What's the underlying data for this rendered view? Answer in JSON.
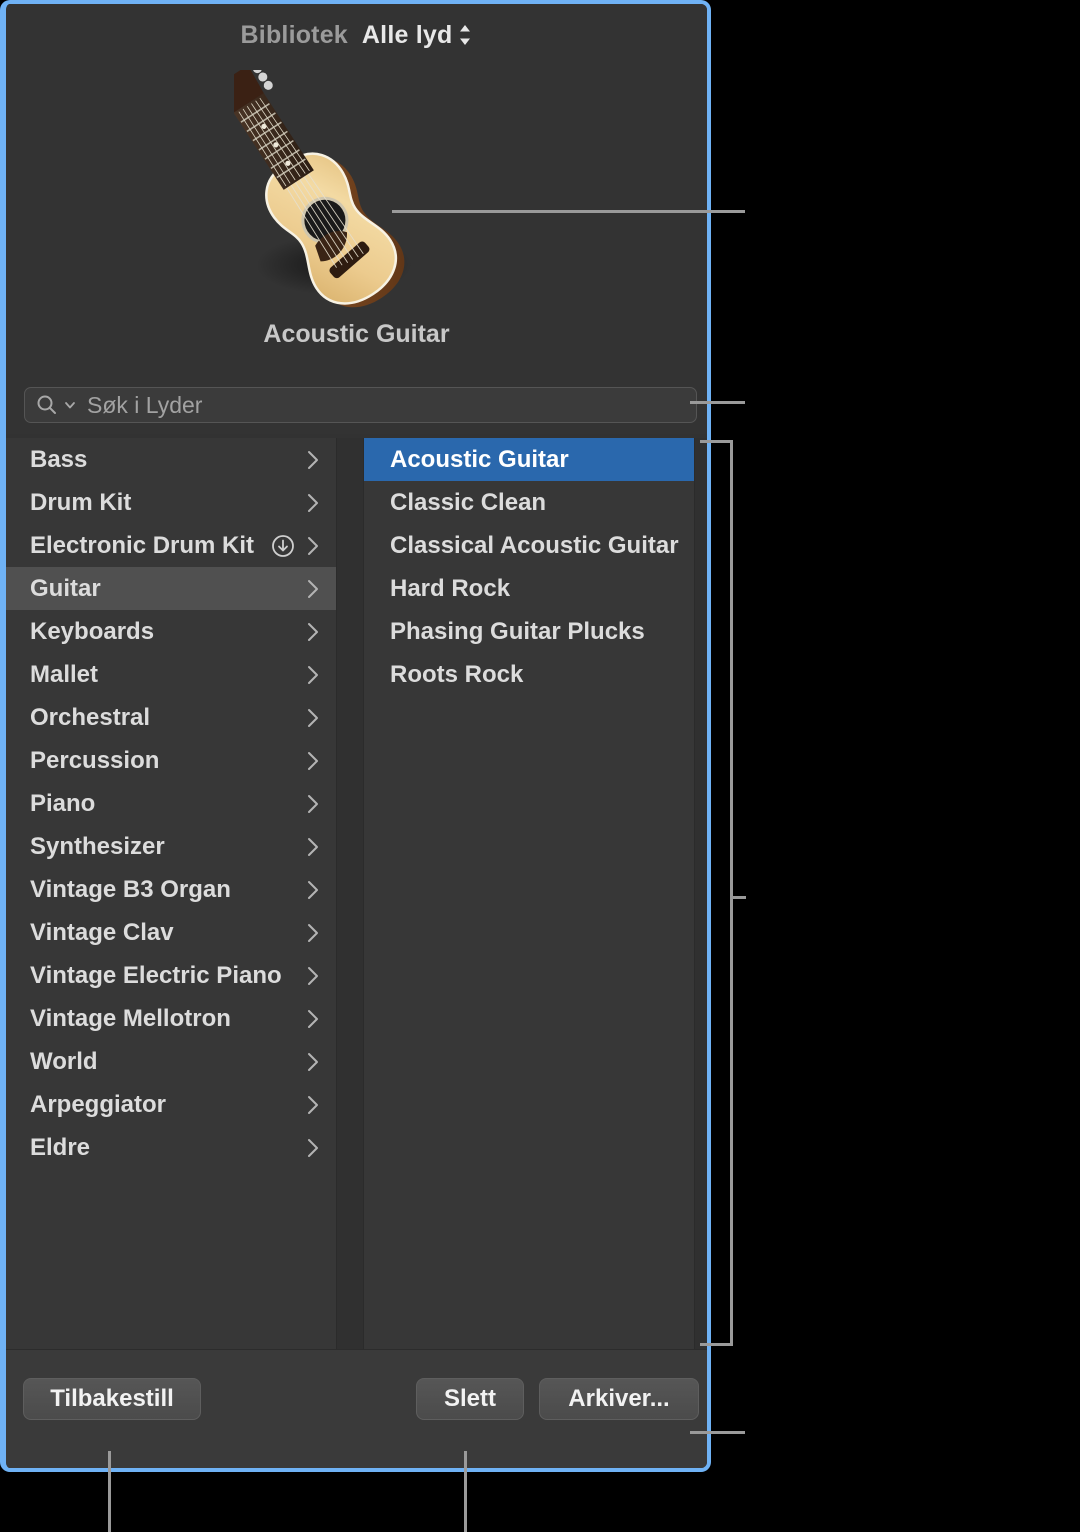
{
  "window": {
    "border_color": "#6fb2f5",
    "background": "#323232"
  },
  "header": {
    "title": "Bibliotek",
    "scope_label": "Alle lyd",
    "scope_icon": "stepper-updown-icon"
  },
  "preview": {
    "artwork_icon": "acoustic-guitar-image",
    "caption": "Acoustic Guitar"
  },
  "search": {
    "placeholder": "Søk i Lyder",
    "value": "",
    "icon": "search-icon",
    "chevron_icon": "chevron-down-icon"
  },
  "browser": {
    "categories": [
      {
        "label": "Bass",
        "selected": false,
        "has_download": false
      },
      {
        "label": "Drum Kit",
        "selected": false,
        "has_download": false
      },
      {
        "label": "Electronic Drum Kit",
        "selected": false,
        "has_download": true
      },
      {
        "label": "Guitar",
        "selected": true,
        "has_download": false
      },
      {
        "label": "Keyboards",
        "selected": false,
        "has_download": false
      },
      {
        "label": "Mallet",
        "selected": false,
        "has_download": false
      },
      {
        "label": "Orchestral",
        "selected": false,
        "has_download": false
      },
      {
        "label": "Percussion",
        "selected": false,
        "has_download": false
      },
      {
        "label": "Piano",
        "selected": false,
        "has_download": false
      },
      {
        "label": "Synthesizer",
        "selected": false,
        "has_download": false
      },
      {
        "label": "Vintage B3 Organ",
        "selected": false,
        "has_download": false
      },
      {
        "label": "Vintage Clav",
        "selected": false,
        "has_download": false
      },
      {
        "label": "Vintage Electric Piano",
        "selected": false,
        "has_download": false
      },
      {
        "label": "Vintage Mellotron",
        "selected": false,
        "has_download": false
      },
      {
        "label": "World",
        "selected": false,
        "has_download": false
      },
      {
        "label": "Arpeggiator",
        "selected": false,
        "has_download": false
      },
      {
        "label": "Eldre",
        "selected": false,
        "has_download": false
      }
    ],
    "patches": [
      {
        "label": "Acoustic Guitar",
        "selected": true
      },
      {
        "label": "Classic Clean",
        "selected": false
      },
      {
        "label": "Classical Acoustic Guitar",
        "selected": false
      },
      {
        "label": "Hard Rock",
        "selected": false
      },
      {
        "label": "Phasing Guitar Plucks",
        "selected": false
      },
      {
        "label": "Roots Rock",
        "selected": false
      }
    ],
    "selection_color": "#2a68ad",
    "category_highlight_color": "#505050"
  },
  "footer": {
    "reset_label": "Tilbakestill",
    "delete_label": "Slett",
    "delete_disabled": true,
    "save_label": "Arkiver..."
  }
}
